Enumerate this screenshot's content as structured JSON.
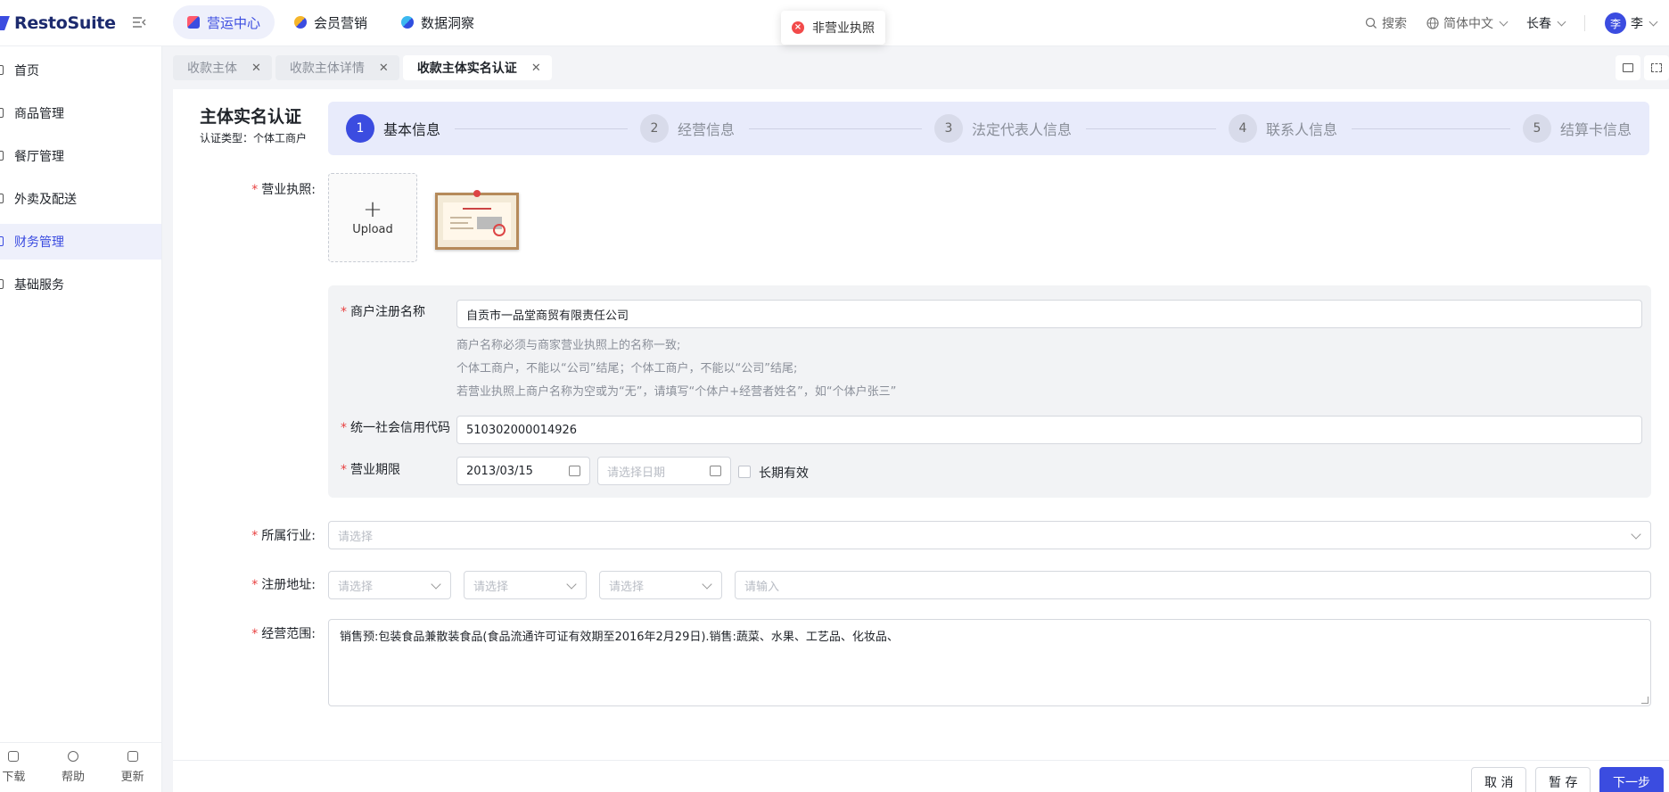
{
  "app": {
    "name": "RestoSuite"
  },
  "topnav": [
    {
      "label": "营运中心",
      "active": true,
      "color": "#3b4ce0"
    },
    {
      "label": "会员营销",
      "active": false,
      "color": "#f0a020"
    },
    {
      "label": "数据洞察",
      "active": false,
      "color": "#2f7be8"
    }
  ],
  "toast": {
    "message": "非营业执照",
    "icon": "error-circle-icon"
  },
  "topright": {
    "search": "搜索",
    "language": "简体中文",
    "city": "长春",
    "avatar_char": "李",
    "user": "李"
  },
  "sidebar": {
    "items": [
      {
        "label": "首页",
        "active": false
      },
      {
        "label": "商品管理",
        "active": false
      },
      {
        "label": "餐厅管理",
        "active": false
      },
      {
        "label": "外卖及配送",
        "active": false
      },
      {
        "label": "财务管理",
        "active": true
      },
      {
        "label": "基础服务",
        "active": false
      }
    ],
    "bottom": [
      {
        "label": "下载",
        "icon": "download-icon"
      },
      {
        "label": "帮助",
        "icon": "help-icon"
      },
      {
        "label": "更新",
        "icon": "update-icon"
      }
    ]
  },
  "tabs": [
    {
      "label": "收款主体",
      "active": false
    },
    {
      "label": "收款主体详情",
      "active": false
    },
    {
      "label": "收款主体实名认证",
      "active": true
    }
  ],
  "page": {
    "title": "主体实名认证",
    "subtitle": "认证类型：个体工商户"
  },
  "steps": [
    {
      "num": "1",
      "label": "基本信息",
      "active": true
    },
    {
      "num": "2",
      "label": "经营信息",
      "active": false
    },
    {
      "num": "3",
      "label": "法定代表人信息",
      "active": false
    },
    {
      "num": "4",
      "label": "联系人信息",
      "active": false
    },
    {
      "num": "5",
      "label": "结算卡信息",
      "active": false
    }
  ],
  "form": {
    "license_label": "营业执照:",
    "upload_label": "Upload",
    "merchant_name_label": "商户注册名称",
    "merchant_name_value": "自贡市一品堂商贸有限责任公司",
    "hints": [
      "商户名称必须与商家营业执照上的名称一致;",
      "个体工商户，不能以“公司”结尾；个体工商户，不能以“公司”结尾;",
      "若营业执照上商户名称为空或为“无”，请填写“个体户+经营者姓名”，如“个体户张三”"
    ],
    "credit_code_label": "统一社会信用代码",
    "credit_code_value": "510302000014926",
    "period_label": "营业期限",
    "period_start": "2013/03/15",
    "period_end_placeholder": "请选择日期",
    "long_term_label": "长期有效",
    "industry_label": "所属行业:",
    "industry_placeholder": "请选择",
    "address_label": "注册地址:",
    "province_placeholder": "请选择",
    "city_placeholder": "请选择",
    "district_placeholder": "请选择",
    "address_input_placeholder": "请输入",
    "scope_label": "经营范围:",
    "scope_value": "销售预:包装食品兼散装食品(食品流通许可证有效期至2016年2月29日).销售:蔬菜、水果、工艺品、化妆品、"
  },
  "buttons": {
    "cancel": "取 消",
    "save": "暂 存",
    "next": "下一步"
  }
}
